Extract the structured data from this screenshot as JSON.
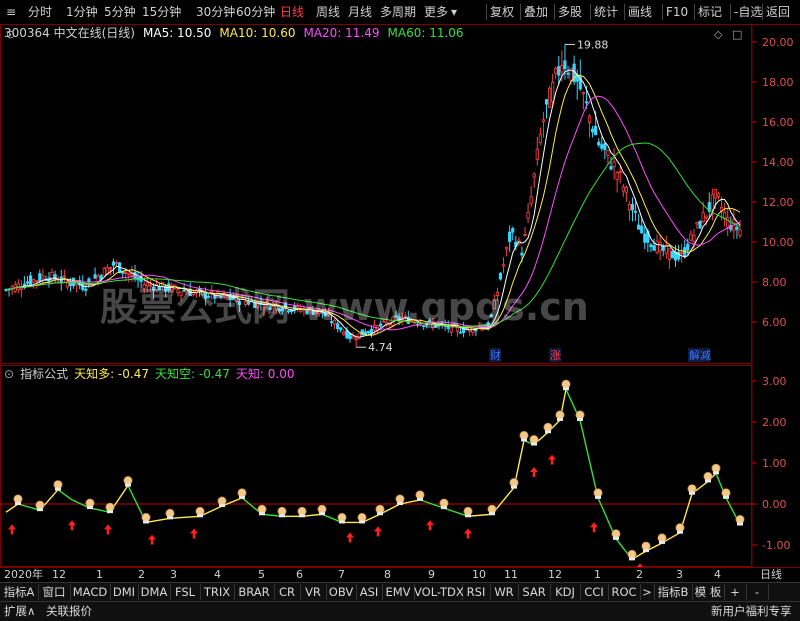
{
  "toolbar": {
    "left_items": [
      "分时",
      "1分钟",
      "5分钟",
      "15分钟",
      "30分钟",
      "60分钟",
      "日线",
      "周线",
      "月线",
      "多周期",
      "更多"
    ],
    "active_index": 6,
    "more_arrow": "▾",
    "right_items": [
      "复权",
      "叠加",
      "多股",
      "统计",
      "画线",
      "F10",
      "标记",
      "-自选",
      "返回"
    ]
  },
  "stock": {
    "title": "300364 中文在线(日线)",
    "ma": [
      {
        "label": "MA5: 10.50",
        "color": "#ffffff"
      },
      {
        "label": "MA10: 10.60",
        "color": "#ffe94a"
      },
      {
        "label": "MA20: 11.49",
        "color": "#ff4dff"
      },
      {
        "label": "MA60: 11.06",
        "color": "#36e036"
      }
    ],
    "high_label": "19.88",
    "low_label": "4.74",
    "y_ticks": [
      "20.00",
      "18.00",
      "16.00",
      "14.00",
      "12.00",
      "10.00",
      "8.00",
      "6.00"
    ],
    "markers": [
      {
        "label": "财",
        "color": "#3a78ff"
      },
      {
        "label": "涨",
        "color": "#ff4040"
      },
      {
        "label": "解减",
        "color": "#3a78ff"
      }
    ],
    "watermark": "股票公式网 www.gpgs.cn"
  },
  "indicator": {
    "title": "指标公式",
    "values": [
      {
        "label": "天知多: -0.47",
        "color": "#ffe94a"
      },
      {
        "label": "天知空: -0.47",
        "color": "#36e036"
      },
      {
        "label": "天知: 0.00",
        "color": "#ff4dff"
      }
    ],
    "y_ticks": [
      "3.00",
      "2.00",
      "1.00",
      "0.00",
      "-1.00"
    ]
  },
  "months": [
    "2020年",
    "12",
    "1",
    "2",
    "3",
    "4",
    "5",
    "6",
    "7",
    "8",
    "9",
    "10",
    "11",
    "12",
    "1",
    "2",
    "3",
    "4"
  ],
  "period_label": "日线",
  "tabs": [
    "指标A",
    "窗口",
    "MACD",
    "DMI",
    "DMA",
    "FSL",
    "TRIX",
    "BRAR",
    "CR",
    "VR",
    "OBV",
    "ASI",
    "EMV",
    "VOL-TDX",
    "RSI",
    "WR",
    "SAR",
    "KDJ",
    "CCI",
    "ROC",
    ">",
    "指标B",
    "模 板",
    "+",
    "-"
  ],
  "bottom": {
    "expand": "扩展∧",
    "quote": "关联报价",
    "promo": "新用户福利专享"
  },
  "colors": {
    "up": "#ff4040",
    "down": "#36d6ff",
    "panel_border": "#7a0000",
    "zero_line": "#c00000"
  }
}
